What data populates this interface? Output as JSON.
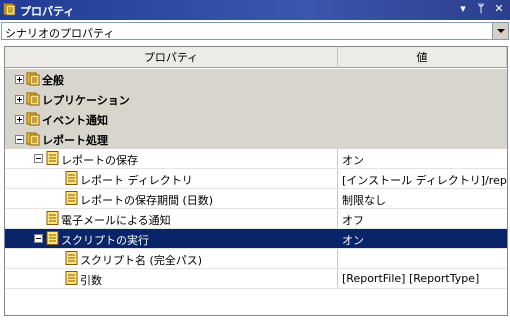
{
  "titlebar": {
    "title": "プロパティ",
    "dropdown_symbol": "▾",
    "pin_symbol": "ᛘ",
    "close_symbol": "✕"
  },
  "selector": {
    "value": "シナリオのプロパティ"
  },
  "grid": {
    "col_property": "プロパティ",
    "col_value": "値",
    "categories": [
      {
        "label": "全般",
        "expanded": false
      },
      {
        "label": "レプリケーション",
        "expanded": false
      },
      {
        "label": "イベント通知",
        "expanded": false
      },
      {
        "label": "レポート処理",
        "expanded": true
      }
    ],
    "properties": [
      {
        "label": "レポートの保存",
        "value": "オン"
      },
      {
        "label": "レポート ディレクトリ",
        "value": "[インストール ディレクトリ]/reports"
      },
      {
        "label": "レポートの保存期間 (日数)",
        "value": "制限なし"
      },
      {
        "label": "電子メールによる通知",
        "value": "オフ"
      },
      {
        "label": "スクリプトの実行",
        "value": "オン",
        "selected": true
      },
      {
        "label": "スクリプト名 (完全パス)",
        "value": ""
      },
      {
        "label": "引数",
        "value": "[ReportFile] [ReportType]"
      }
    ]
  }
}
